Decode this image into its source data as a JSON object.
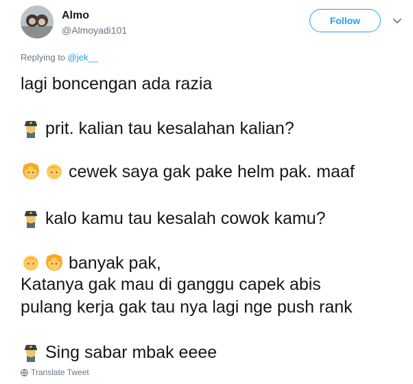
{
  "user": {
    "name": "Almo",
    "handle": "@Almoyadi101"
  },
  "follow_label": "Follow",
  "reply": {
    "prefix": "Replying to",
    "mention": "@jek__"
  },
  "tweet": {
    "line1": "lagi boncengan ada razia",
    "line2": "prit. kalian tau kesalahan kalian?",
    "line3": "cewek saya gak pake helm pak. maaf",
    "line4": "kalo kamu tau kesalah cowok kamu?",
    "line5": "banyak pak,",
    "line6": "Katanya gak mau di ganggu capek abis",
    "line7": "pulang kerja gak tau nya lagi nge push rank",
    "line8": "Sing sabar mbak eeee"
  },
  "translate_label": "Translate Tweet",
  "icons": {
    "police": "police-officer-emoji",
    "girl": "girl-emoji",
    "boy": "boy-emoji"
  },
  "colors": {
    "accent": "#1da1f2",
    "muted": "#657786",
    "text": "#14171a"
  }
}
